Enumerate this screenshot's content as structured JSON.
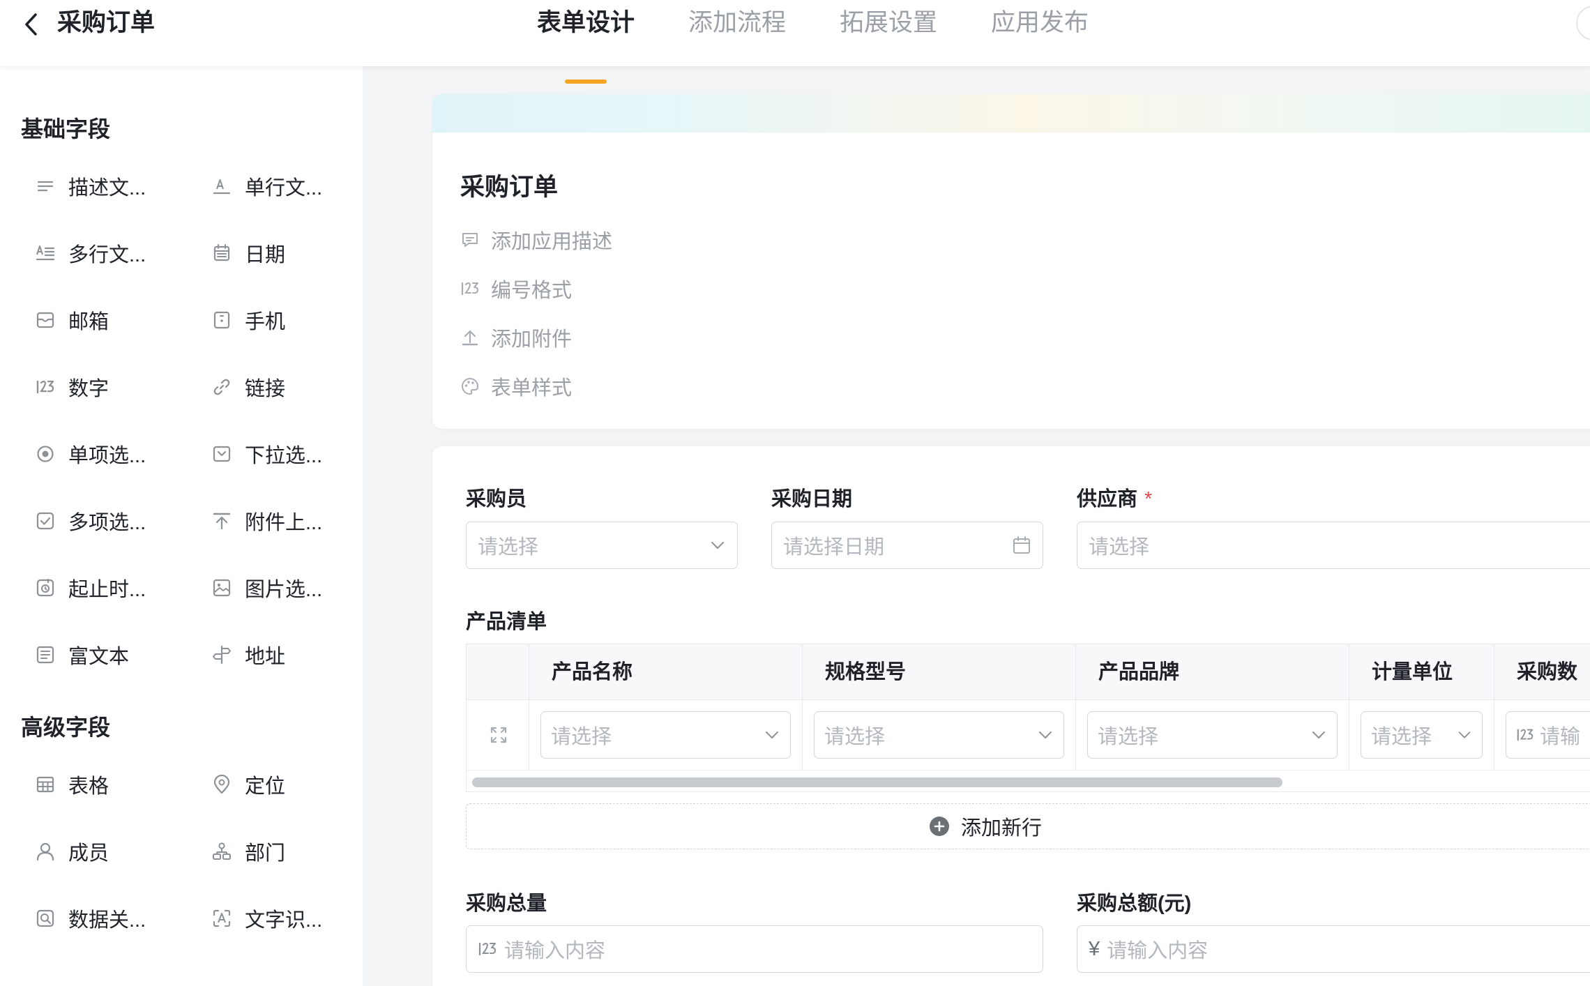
{
  "header": {
    "title": "采购订单",
    "tabs": [
      {
        "label": "表单设计",
        "active": true
      },
      {
        "label": "添加流程",
        "active": false
      },
      {
        "label": "拓展设置",
        "active": false
      },
      {
        "label": "应用发布",
        "active": false
      }
    ],
    "accent_color": "#f5a623"
  },
  "sidebar": {
    "basic_title": "基础字段",
    "basic_fields": [
      {
        "label": "描述文...",
        "icon": "description-text-icon"
      },
      {
        "label": "单行文...",
        "icon": "single-line-text-icon"
      },
      {
        "label": "多行文...",
        "icon": "multi-line-text-icon"
      },
      {
        "label": "日期",
        "icon": "date-icon"
      },
      {
        "label": "邮箱",
        "icon": "email-icon"
      },
      {
        "label": "手机",
        "icon": "phone-icon"
      },
      {
        "label": "数字",
        "icon": "number-icon"
      },
      {
        "label": "链接",
        "icon": "link-icon"
      },
      {
        "label": "单项选...",
        "icon": "radio-icon"
      },
      {
        "label": "下拉选...",
        "icon": "dropdown-icon"
      },
      {
        "label": "多项选...",
        "icon": "checkbox-icon"
      },
      {
        "label": "附件上...",
        "icon": "upload-icon"
      },
      {
        "label": "起止时...",
        "icon": "time-range-icon"
      },
      {
        "label": "图片选...",
        "icon": "image-icon"
      },
      {
        "label": "富文本",
        "icon": "rich-text-icon"
      },
      {
        "label": "地址",
        "icon": "address-icon"
      }
    ],
    "advanced_title": "高级字段",
    "advanced_fields": [
      {
        "label": "表格",
        "icon": "table-icon"
      },
      {
        "label": "定位",
        "icon": "location-icon"
      },
      {
        "label": "成员",
        "icon": "member-icon"
      },
      {
        "label": "部门",
        "icon": "department-icon"
      },
      {
        "label": "数据关...",
        "icon": "data-relation-icon"
      },
      {
        "label": "文字识...",
        "icon": "ocr-icon"
      }
    ]
  },
  "form_info": {
    "title": "采购订单",
    "actions": [
      {
        "label": "添加应用描述",
        "icon": "comment-icon"
      },
      {
        "label": "编号格式",
        "icon": "number-format-icon"
      },
      {
        "label": "添加附件",
        "icon": "upload-icon"
      },
      {
        "label": "表单样式",
        "icon": "palette-icon"
      }
    ]
  },
  "form_body": {
    "buyer": {
      "label": "采购员",
      "placeholder": "请选择"
    },
    "purchase_date": {
      "label": "采购日期",
      "placeholder": "请选择日期"
    },
    "supplier": {
      "label": "供应商",
      "required_mark": "*",
      "placeholder": "请选择"
    },
    "product_list": {
      "label": "产品清单",
      "columns": [
        "产品名称",
        "规格型号",
        "产品品牌",
        "计量单位",
        "采购数"
      ],
      "row_placeholders": [
        "请选择",
        "请选择",
        "请选择",
        "请选择",
        "请输"
      ],
      "add_row_label": "添加新行"
    },
    "total_quantity": {
      "label": "采购总量",
      "placeholder": "请输入内容"
    },
    "total_amount": {
      "label": "采购总额(元)",
      "placeholder": "请输入内容",
      "prefix": "¥"
    }
  }
}
